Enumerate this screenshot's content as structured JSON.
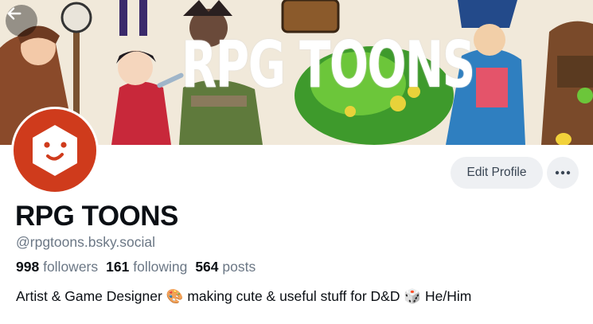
{
  "banner": {
    "title": "RPG TOONS"
  },
  "header": {
    "back_icon": "arrow-left-icon"
  },
  "profile": {
    "display_name": "RPG TOONS",
    "handle": "@rpgtoons.bsky.social",
    "followers_count": "998",
    "followers_label": "followers",
    "following_count": "161",
    "following_label": "following",
    "posts_count": "564",
    "posts_label": "posts",
    "bio": "Artist & Game Designer 🎨 making cute & useful stuff for D&D 🎲 He/Him"
  },
  "actions": {
    "edit_label": "Edit Profile",
    "more_icon": "ellipsis-icon"
  },
  "colors": {
    "avatar_bg": "#cf3b1c",
    "button_bg": "#eef0f3",
    "muted_text": "#6b7785"
  }
}
